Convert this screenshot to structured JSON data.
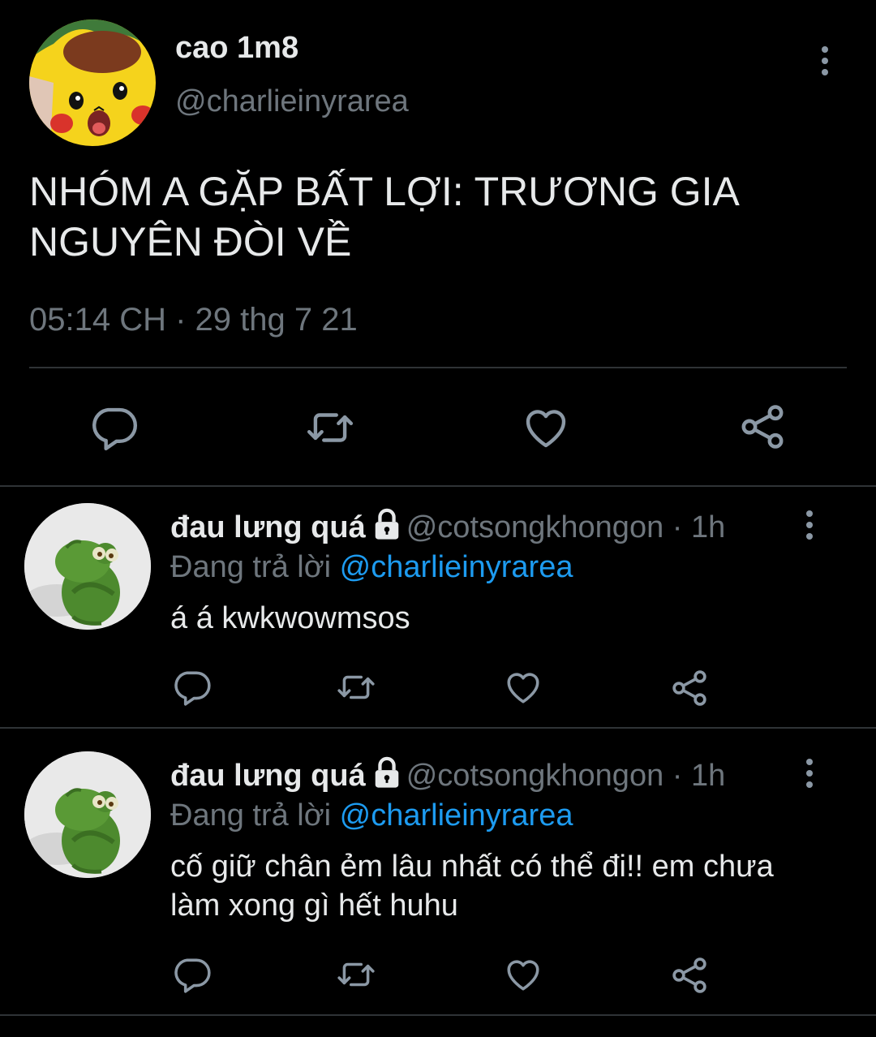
{
  "main_tweet": {
    "display_name": "cao 1m8",
    "handle": "@charlieinyrarea",
    "text": "NHÓM A GẶP BẤT LỢI: TRƯƠNG GIA NGUYÊN ĐÒI VỀ",
    "timestamp": "05:14 CH · 29 thg 7 21",
    "avatar": "pikachu-avatar",
    "actions": [
      "reply-icon",
      "retweet-icon",
      "like-icon",
      "share-icon"
    ]
  },
  "replies": [
    {
      "display_name": "đau lưng quá",
      "handle": "@cotsongkhongon",
      "time": " · 1h",
      "replying_label": "Đang trả lời ",
      "replying_to": "@charlieinyrarea",
      "text": "á á kwkwowmsos",
      "avatar": "kermit-avatar"
    },
    {
      "display_name": "đau lưng quá",
      "handle": "@cotsongkhongon",
      "time": " · 1h",
      "replying_label": "Đang trả lời ",
      "replying_to": "@charlieinyrarea",
      "text": "cố giữ chân ẻm lâu nhất có thể đi!! em chưa làm xong gì hết huhu",
      "avatar": "kermit-avatar"
    }
  ],
  "colors": {
    "background": "#000000",
    "text": "#e7e9ea",
    "secondary_text": "#6e767d",
    "accent": "#1d9bf0",
    "divider": "#2f3336"
  }
}
